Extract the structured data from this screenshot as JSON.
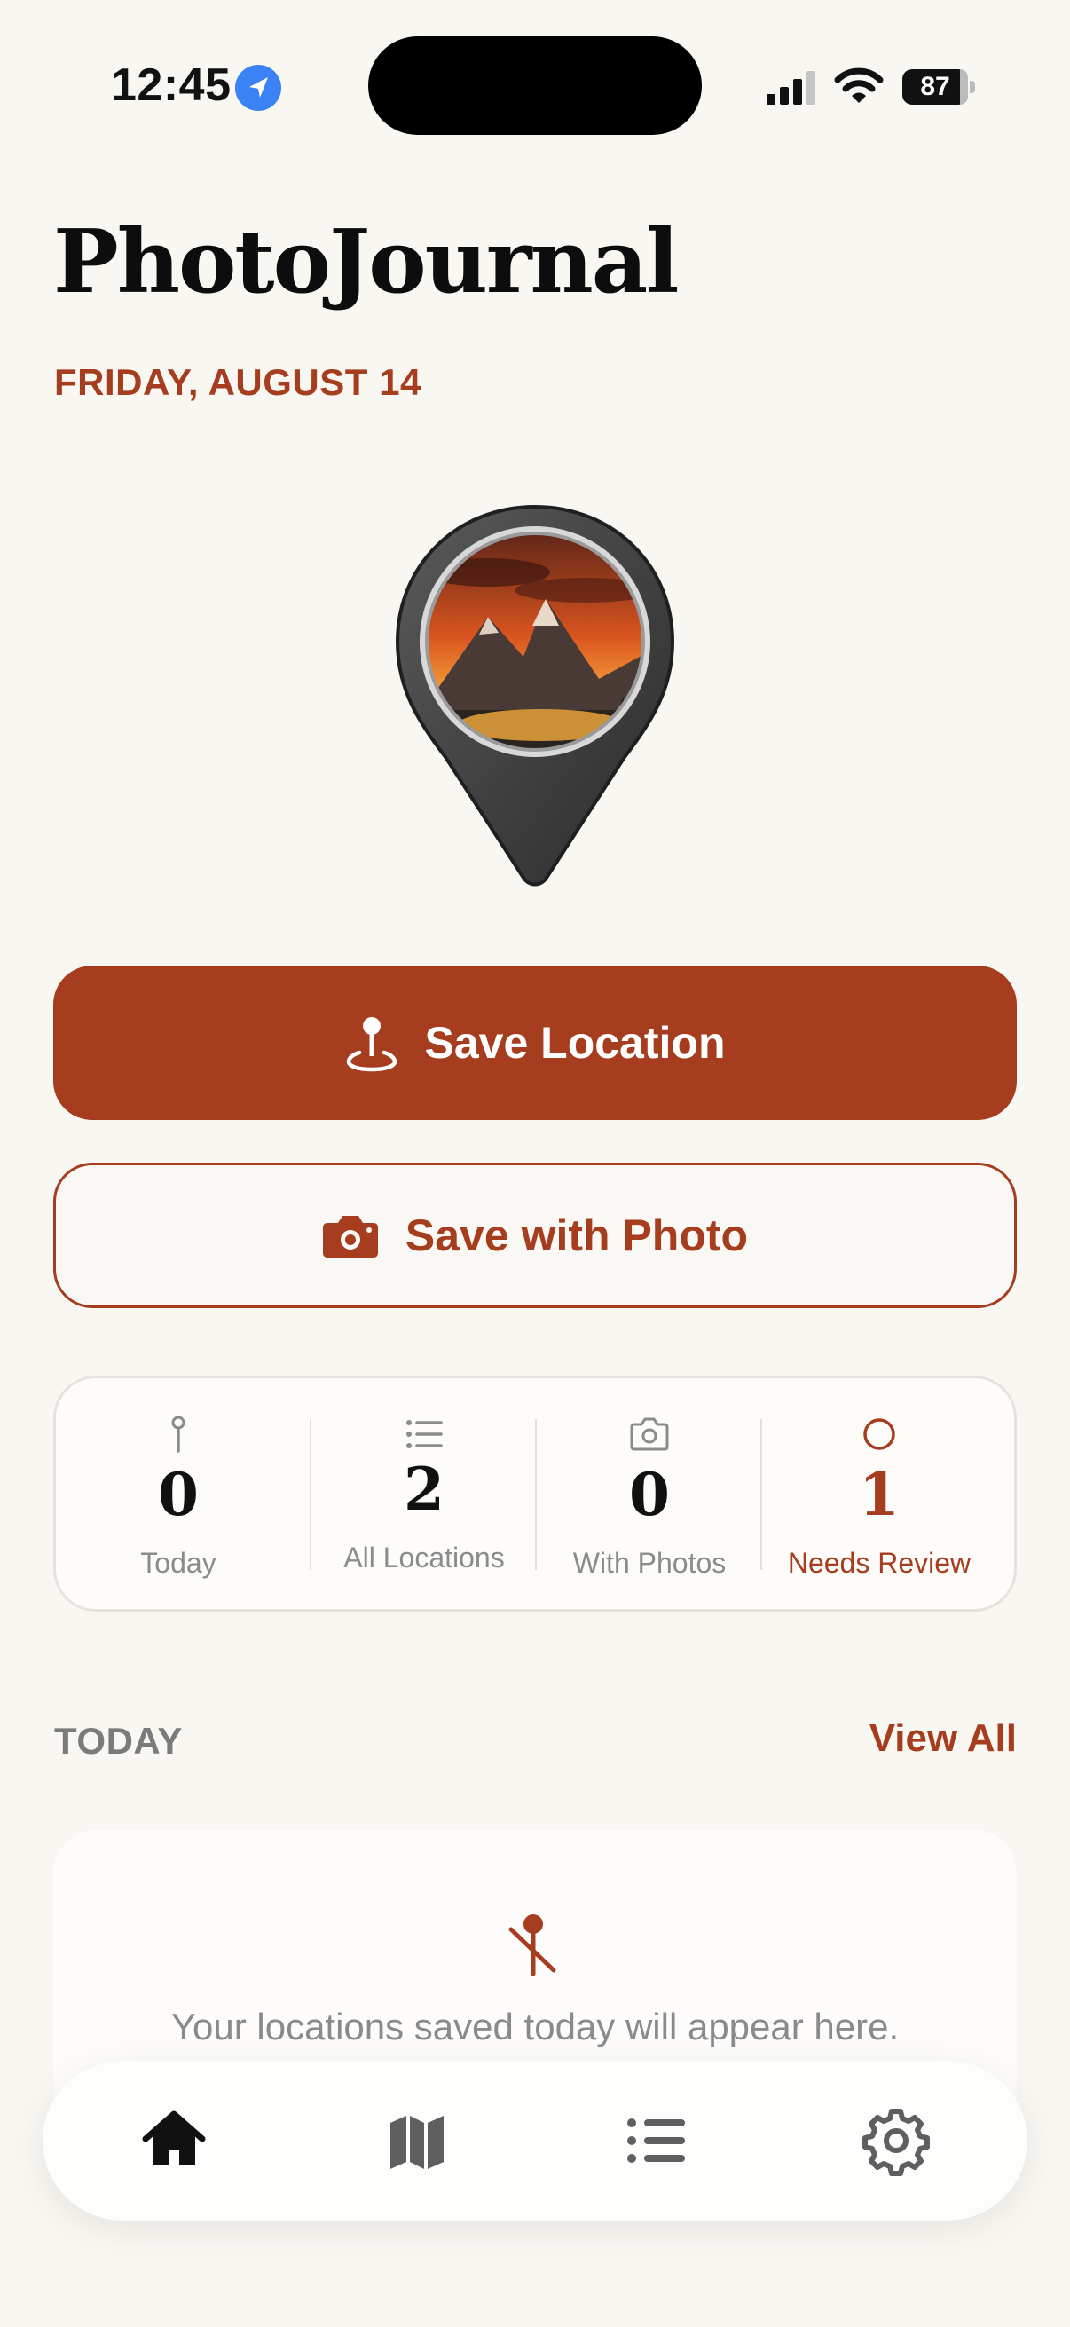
{
  "status_bar": {
    "time": "12:45",
    "battery": "87"
  },
  "app": {
    "title": "PhotoJournal",
    "date": "FRIDAY, AUGUST 14"
  },
  "actions": {
    "save_location": "Save Location",
    "save_with_photo": "Save with Photo"
  },
  "stats": [
    {
      "icon": "pin-icon",
      "value": "0",
      "label": "Today"
    },
    {
      "icon": "list-icon",
      "value": "2",
      "label": "All Locations"
    },
    {
      "icon": "camera-icon",
      "value": "0",
      "label": "With Photos"
    },
    {
      "icon": "circle-icon",
      "value": "1",
      "label": "Needs Review"
    }
  ],
  "today": {
    "section_label": "TODAY",
    "view_all": "View All",
    "empty_text": "Your locations saved today will appear here."
  },
  "tabbar": [
    "home-icon",
    "map-icon",
    "list-icon",
    "gear-icon"
  ],
  "colors": {
    "accent": "#a53d1e",
    "background": "#f9f7f2"
  }
}
